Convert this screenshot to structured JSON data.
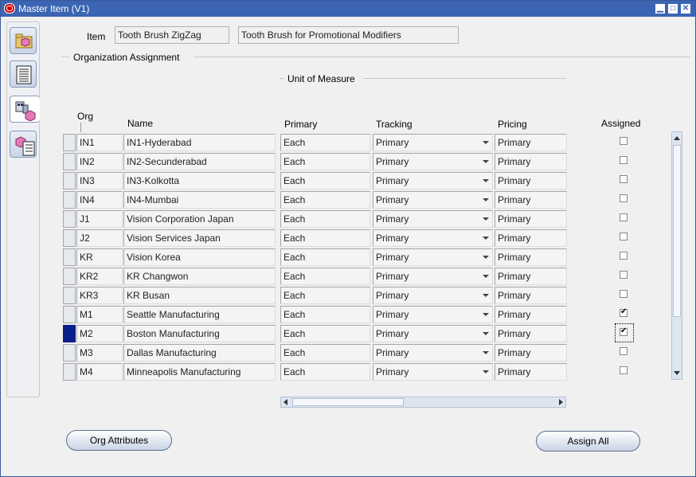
{
  "window": {
    "title": "Master Item (V1)",
    "minimize": "▁",
    "maximize": "□",
    "close": "✕"
  },
  "side_tabs": [
    {
      "icon": "folder-cube-icon"
    },
    {
      "icon": "list-icon"
    },
    {
      "icon": "organization-cube-icon"
    },
    {
      "icon": "item-list-icon"
    }
  ],
  "header": {
    "item_label": "Item",
    "item_value": "Tooth Brush ZigZag",
    "description_value": "Tooth Brush for Promotional Modifiers"
  },
  "section_title": "Organization Assignment",
  "group_title": "Unit of Measure",
  "columns": {
    "org": "Org",
    "name": "Name",
    "primary": "Primary",
    "tracking": "Tracking",
    "pricing": "Pricing",
    "assigned": "Assigned"
  },
  "rows": [
    {
      "org": "IN1",
      "name": "IN1-Hyderabad",
      "primary": "Each",
      "tracking": "Primary",
      "pricing": "Primary",
      "assigned": false,
      "current": false
    },
    {
      "org": "IN2",
      "name": "IN2-Secunderabad",
      "primary": "Each",
      "tracking": "Primary",
      "pricing": "Primary",
      "assigned": false,
      "current": false
    },
    {
      "org": "IN3",
      "name": "IN3-Kolkotta",
      "primary": "Each",
      "tracking": "Primary",
      "pricing": "Primary",
      "assigned": false,
      "current": false
    },
    {
      "org": "IN4",
      "name": "IN4-Mumbai",
      "primary": "Each",
      "tracking": "Primary",
      "pricing": "Primary",
      "assigned": false,
      "current": false
    },
    {
      "org": "J1",
      "name": "Vision Corporation Japan",
      "primary": "Each",
      "tracking": "Primary",
      "pricing": "Primary",
      "assigned": false,
      "current": false
    },
    {
      "org": "J2",
      "name": "Vision Services Japan",
      "primary": "Each",
      "tracking": "Primary",
      "pricing": "Primary",
      "assigned": false,
      "current": false
    },
    {
      "org": "KR",
      "name": "Vision Korea",
      "primary": "Each",
      "tracking": "Primary",
      "pricing": "Primary",
      "assigned": false,
      "current": false
    },
    {
      "org": "KR2",
      "name": "KR Changwon",
      "primary": "Each",
      "tracking": "Primary",
      "pricing": "Primary",
      "assigned": false,
      "current": false
    },
    {
      "org": "KR3",
      "name": "KR Busan",
      "primary": "Each",
      "tracking": "Primary",
      "pricing": "Primary",
      "assigned": false,
      "current": false
    },
    {
      "org": "M1",
      "name": "Seattle Manufacturing",
      "primary": "Each",
      "tracking": "Primary",
      "pricing": "Primary",
      "assigned": true,
      "current": false
    },
    {
      "org": "M2",
      "name": "Boston Manufacturing",
      "primary": "Each",
      "tracking": "Primary",
      "pricing": "Primary",
      "assigned": true,
      "current": true
    },
    {
      "org": "M3",
      "name": "Dallas Manufacturing",
      "primary": "Each",
      "tracking": "Primary",
      "pricing": "Primary",
      "assigned": false,
      "current": false
    },
    {
      "org": "M4",
      "name": "Minneapolis Manufacturing",
      "primary": "Each",
      "tracking": "Primary",
      "pricing": "Primary",
      "assigned": false,
      "current": false
    }
  ],
  "buttons": {
    "org_attributes": "Org Attributes",
    "assign_all": "Assign All"
  },
  "colors": {
    "title_bar": "#3b65b3",
    "current_row": "#0b1f8a"
  }
}
